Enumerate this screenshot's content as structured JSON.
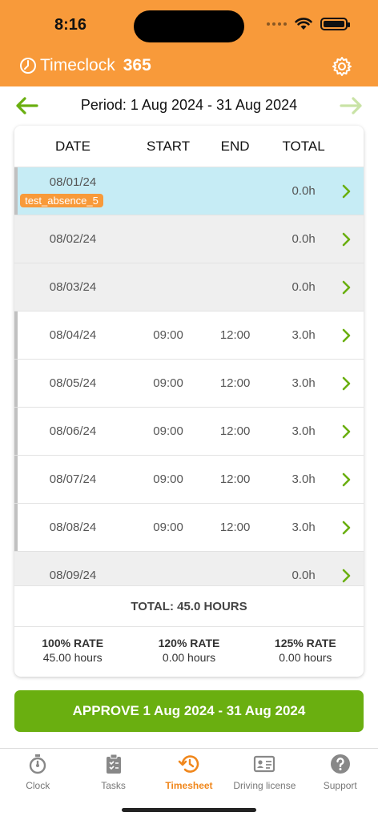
{
  "status_bar": {
    "time": "8:16"
  },
  "app": {
    "name": "Timeclock",
    "name_suffix": "365"
  },
  "period": {
    "label": "Period: 1 Aug 2024 - 31 Aug 2024"
  },
  "table": {
    "headers": [
      "DATE",
      "START",
      "END",
      "TOTAL"
    ],
    "rows": [
      {
        "date": "08/01/24",
        "start": "",
        "end": "",
        "total": "0.0h",
        "badge": "test_absence_5"
      },
      {
        "date": "08/02/24",
        "start": "",
        "end": "",
        "total": "0.0h"
      },
      {
        "date": "08/03/24",
        "start": "",
        "end": "",
        "total": "0.0h"
      },
      {
        "date": "08/04/24",
        "start": "09:00",
        "end": "12:00",
        "total": "3.0h"
      },
      {
        "date": "08/05/24",
        "start": "09:00",
        "end": "12:00",
        "total": "3.0h"
      },
      {
        "date": "08/06/24",
        "start": "09:00",
        "end": "12:00",
        "total": "3.0h"
      },
      {
        "date": "08/07/24",
        "start": "09:00",
        "end": "12:00",
        "total": "3.0h"
      },
      {
        "date": "08/08/24",
        "start": "09:00",
        "end": "12:00",
        "total": "3.0h"
      },
      {
        "date": "08/09/24",
        "start": "",
        "end": "",
        "total": "0.0h"
      }
    ]
  },
  "summary": {
    "total": "TOTAL: 45.0 HOURS",
    "rates": [
      {
        "label": "100% RATE",
        "value": "45.00 hours"
      },
      {
        "label": "120% RATE",
        "value": "0.00 hours"
      },
      {
        "label": "125% RATE",
        "value": "0.00 hours"
      }
    ]
  },
  "approve_button": {
    "label": "APPROVE 1 Aug 2024 - 31 Aug 2024"
  },
  "tabs": [
    {
      "label": "Clock",
      "icon": "stopwatch-icon"
    },
    {
      "label": "Tasks",
      "icon": "clipboard-icon"
    },
    {
      "label": "Timesheet",
      "icon": "history-icon",
      "active": true
    },
    {
      "label": "Driving license",
      "icon": "id-card-icon"
    },
    {
      "label": "Support",
      "icon": "question-icon"
    }
  ],
  "colors": {
    "brand": "#f89a3a",
    "accent_green": "#6aaf10",
    "absence_row": "#c6ecf5",
    "active_tab": "#f0871c"
  }
}
